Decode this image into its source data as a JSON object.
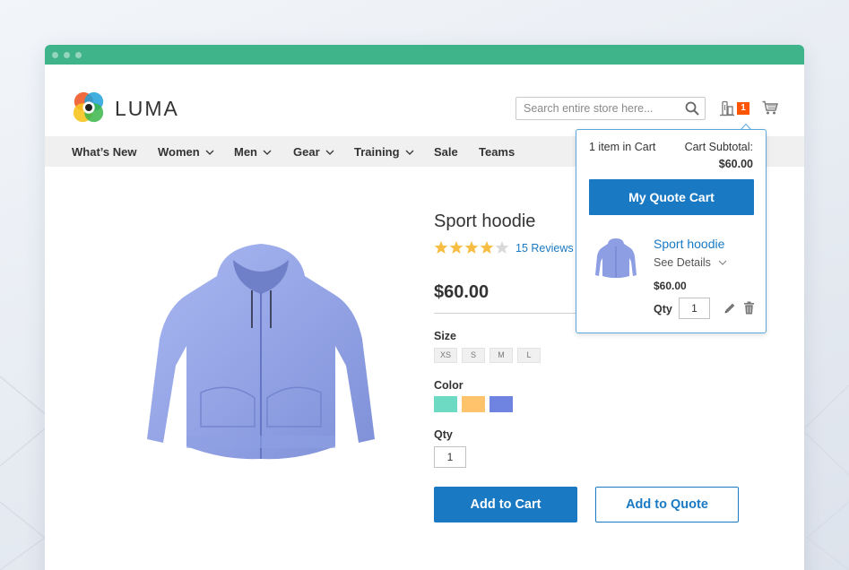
{
  "header": {
    "brand": "LUMA",
    "search": {
      "placeholder": "Search entire store here..."
    },
    "quote_badge": "1"
  },
  "nav": {
    "items": [
      {
        "label": "What’s New",
        "has_dropdown": false
      },
      {
        "label": "Women",
        "has_dropdown": true
      },
      {
        "label": "Men",
        "has_dropdown": true
      },
      {
        "label": "Gear",
        "has_dropdown": true
      },
      {
        "label": "Training",
        "has_dropdown": true
      },
      {
        "label": "Sale",
        "has_dropdown": false
      },
      {
        "label": "Teams",
        "has_dropdown": false
      }
    ]
  },
  "product": {
    "title": "Sport hoodie",
    "rating": 4,
    "rating_max": 5,
    "reviews": "15 Reviews",
    "price": "$60.00",
    "size_label": "Size",
    "sizes": [
      "XS",
      "S",
      "M",
      "L"
    ],
    "color_label": "Color",
    "colors": [
      "#6ddbc4",
      "#ffc46b",
      "#6f83e0"
    ],
    "qty_label": "Qty",
    "qty_value": "1",
    "add_to_cart": "Add to Cart",
    "add_to_quote": "Add to Quote"
  },
  "quote_dropdown": {
    "item_count": "1 item in Cart",
    "subtotal_label": "Cart Subtotal:",
    "subtotal_value": "$60.00",
    "button": "My Quote Cart",
    "item": {
      "name": "Sport hoodie",
      "see_details": "See Details",
      "price": "$60.00",
      "qty_label": "Qty",
      "qty_value": "1"
    }
  },
  "colors": {
    "titlebar": "#3fb38a",
    "primary": "#1979c3",
    "badge": "#ff5501",
    "star_on": "#f6bd42",
    "star_off": "#d9d9d9"
  }
}
